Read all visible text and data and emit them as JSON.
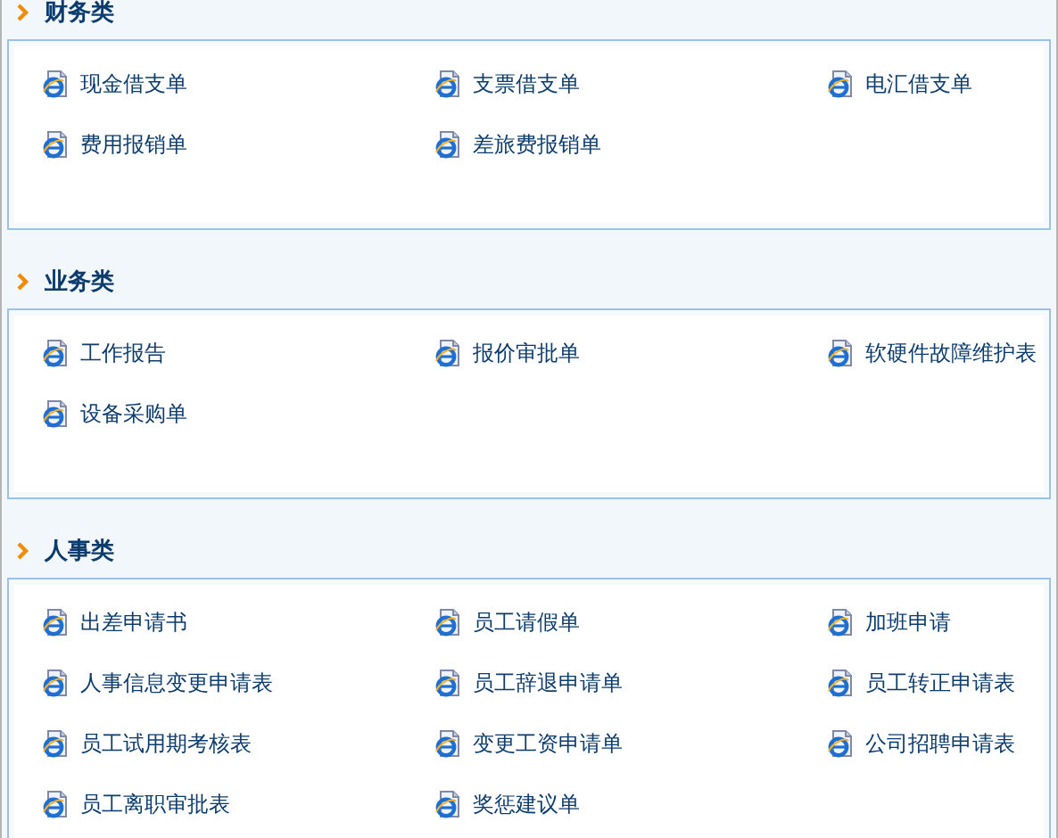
{
  "sections": [
    {
      "title": "财务类",
      "items": [
        "现金借支单",
        "支票借支单",
        "电汇借支单",
        "费用报销单",
        "差旅费报销单"
      ]
    },
    {
      "title": "业务类",
      "items": [
        "工作报告",
        "报价审批单",
        "软硬件故障维护表",
        "设备采购单"
      ]
    },
    {
      "title": "人事类",
      "items": [
        "出差申请书",
        "员工请假单",
        "加班申请",
        "人事信息变更申请表",
        "员工辞退申请单",
        "员工转正申请表",
        "员工试用期考核表",
        "变更工资申请单",
        "公司招聘申请表",
        "员工离职审批表",
        "奖惩建议单"
      ]
    }
  ]
}
